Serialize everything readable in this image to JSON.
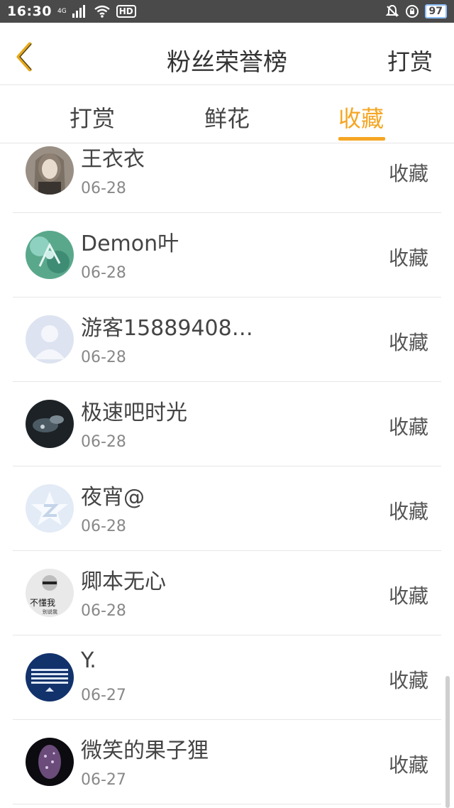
{
  "status_bar": {
    "time": "16:30",
    "network_small": "4G",
    "hd_label": "HD",
    "battery": "97"
  },
  "header": {
    "title": "粉丝荣誉榜",
    "reward_label": "打赏"
  },
  "tabs": [
    {
      "label": "打赏"
    },
    {
      "label": "鲜花"
    },
    {
      "label": "收藏"
    }
  ],
  "active_tab": "收藏",
  "list": {
    "rows": [
      {
        "name": "王衣衣",
        "date": "06-28",
        "action": "收藏"
      },
      {
        "name": "Demon叶",
        "date": "06-28",
        "action": "收藏"
      },
      {
        "name": "游客15889408…",
        "date": "06-28",
        "action": "收藏"
      },
      {
        "name": "极速吧时光",
        "date": "06-28",
        "action": "收藏"
      },
      {
        "name": "夜宵@",
        "date": "06-28",
        "action": "收藏"
      },
      {
        "name": "卿本无心",
        "date": "06-28",
        "action": "收藏"
      },
      {
        "name": "Y.",
        "date": "06-27",
        "action": "收藏"
      },
      {
        "name": "微笑的果子狸",
        "date": "06-27",
        "action": "收藏"
      }
    ]
  },
  "avatar_texts": {
    "row6_line1": "不懂我",
    "row6_line2": "别说我"
  },
  "colors": {
    "accent": "#f5a623",
    "status_bar_bg": "#4a4a4a"
  }
}
